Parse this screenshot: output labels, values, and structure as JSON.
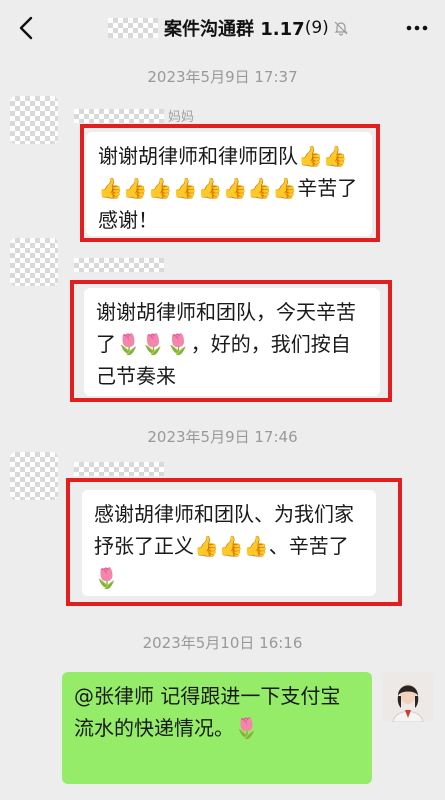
{
  "header": {
    "title": "案件沟通群 1.17",
    "member_count": "(9)",
    "icons": [
      "back-arrow-icon",
      "mute-bell-icon",
      "more-dots-icon"
    ]
  },
  "timestamps": [
    "2023年5月9日 17:37",
    "2023年5月9日 17:46",
    "2023年5月10日 16:16"
  ],
  "messages": [
    {
      "sender": "妈妈",
      "text": "谢谢胡律师和律师团队👍👍👍👍👍👍👍👍👍👍辛苦了感谢！"
    },
    {
      "sender": "",
      "text": "谢谢胡律师和团队，今天辛苦了🌷🌷🌷，好的，我们按自己节奏来"
    },
    {
      "sender": "",
      "text": "感谢胡律师和团队、为我们家抒张了正义👍👍👍、辛苦了🌷"
    },
    {
      "sender": "me",
      "text": "@张律师 记得跟进一下支付宝流水的快递情况。🌷"
    }
  ],
  "colors": {
    "bg": "#ededed",
    "bubble": "#ffffff",
    "my_bubble": "#95ec69",
    "highlight": "#e11f1f"
  }
}
